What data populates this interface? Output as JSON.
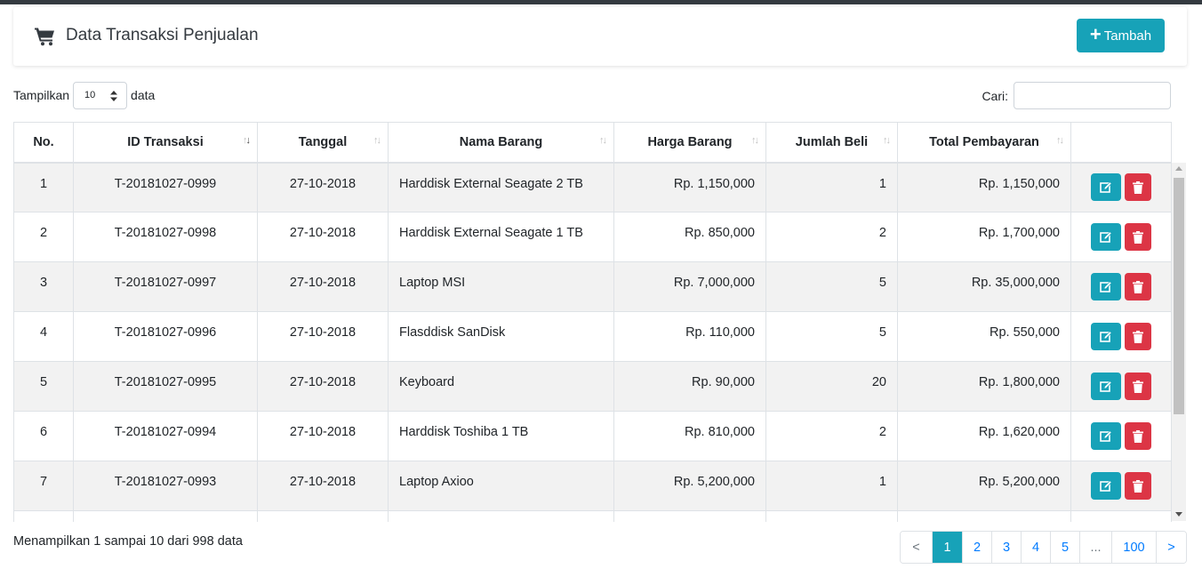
{
  "header": {
    "title": "Data Transaksi Penjualan",
    "add_label": "Tambah"
  },
  "length": {
    "prefix": "Tampilkan",
    "value": "10",
    "suffix": "data"
  },
  "search": {
    "label": "Cari:",
    "value": ""
  },
  "table": {
    "columns": [
      "No.",
      "ID Transaksi",
      "Tanggal",
      "Nama Barang",
      "Harga Barang",
      "Jumlah Beli",
      "Total Pembayaran",
      ""
    ],
    "rows": [
      {
        "no": "1",
        "id": "T-20181027-0999",
        "tanggal": "27-10-2018",
        "nama": "Harddisk External Seagate 2 TB",
        "harga": "Rp. 1,150,000",
        "jumlah": "1",
        "total": "Rp. 1,150,000"
      },
      {
        "no": "2",
        "id": "T-20181027-0998",
        "tanggal": "27-10-2018",
        "nama": "Harddisk External Seagate 1 TB",
        "harga": "Rp. 850,000",
        "jumlah": "2",
        "total": "Rp. 1,700,000"
      },
      {
        "no": "3",
        "id": "T-20181027-0997",
        "tanggal": "27-10-2018",
        "nama": "Laptop MSI",
        "harga": "Rp. 7,000,000",
        "jumlah": "5",
        "total": "Rp. 35,000,000"
      },
      {
        "no": "4",
        "id": "T-20181027-0996",
        "tanggal": "27-10-2018",
        "nama": "Flasddisk SanDisk",
        "harga": "Rp. 110,000",
        "jumlah": "5",
        "total": "Rp. 550,000"
      },
      {
        "no": "5",
        "id": "T-20181027-0995",
        "tanggal": "27-10-2018",
        "nama": "Keyboard",
        "harga": "Rp. 90,000",
        "jumlah": "20",
        "total": "Rp. 1,800,000"
      },
      {
        "no": "6",
        "id": "T-20181027-0994",
        "tanggal": "27-10-2018",
        "nama": "Harddisk Toshiba 1 TB",
        "harga": "Rp. 810,000",
        "jumlah": "2",
        "total": "Rp. 1,620,000"
      },
      {
        "no": "7",
        "id": "T-20181027-0993",
        "tanggal": "27-10-2018",
        "nama": "Laptop Axioo",
        "harga": "Rp. 5,200,000",
        "jumlah": "1",
        "total": "Rp. 5,200,000"
      },
      {
        "no": "",
        "id": "",
        "tanggal": "",
        "nama": "",
        "harga": "",
        "jumlah": "",
        "total": ""
      }
    ]
  },
  "info": "Menampilkan 1 sampai 10 dari 998 data",
  "pagination": [
    "<",
    "1",
    "2",
    "3",
    "4",
    "5",
    "...",
    "100",
    ">"
  ],
  "colors": {
    "accent": "#17a2b8",
    "danger": "#dc3545",
    "link": "#007bff",
    "topbar": "#343a40"
  }
}
